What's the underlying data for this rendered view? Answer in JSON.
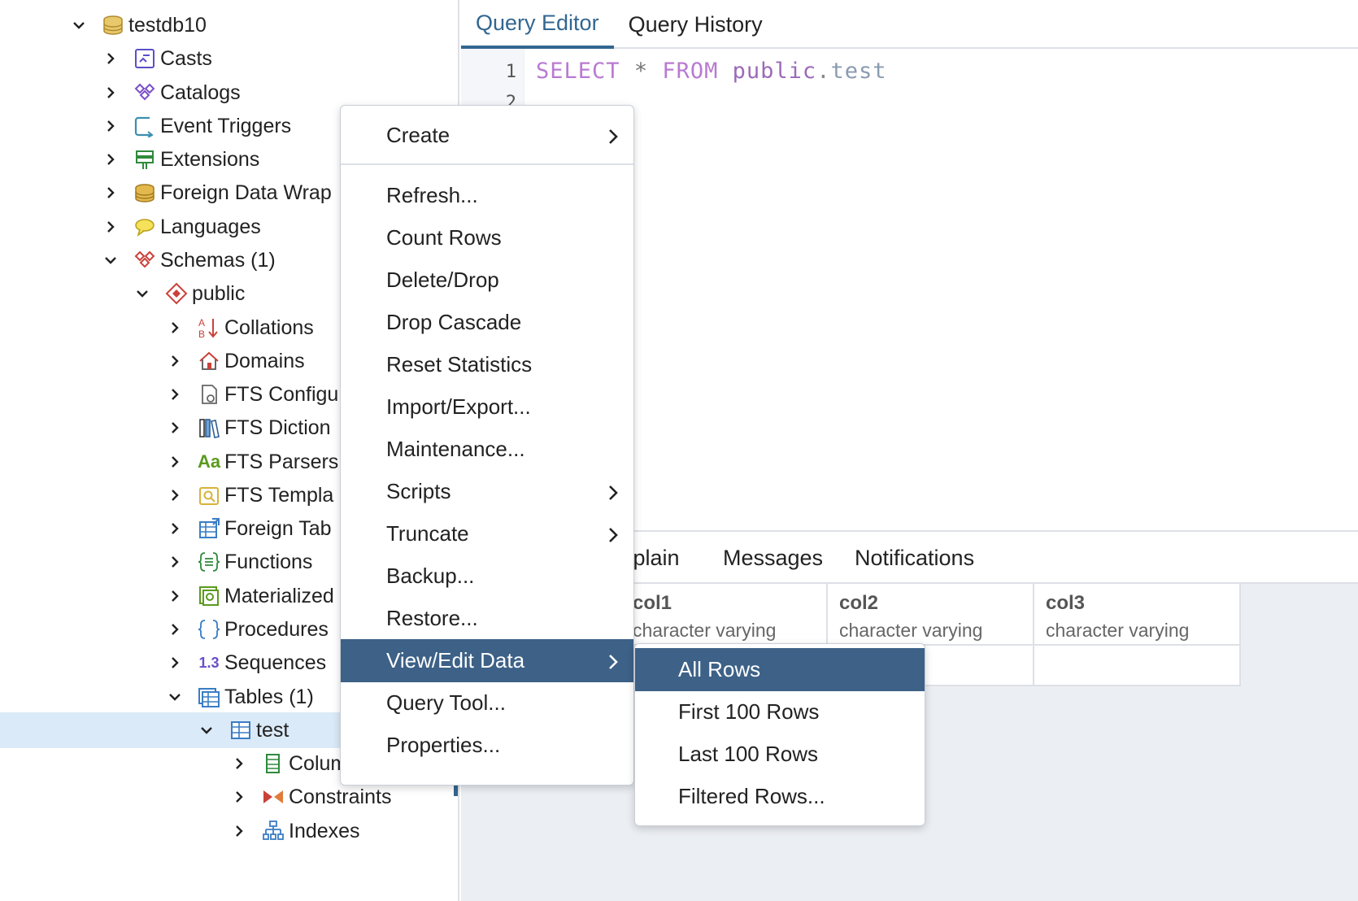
{
  "tree": {
    "items": [
      {
        "label": "testdb10",
        "icon": "database-icon"
      },
      {
        "label": "Casts",
        "icon": "casts-icon"
      },
      {
        "label": "Catalogs",
        "icon": "catalogs-icon"
      },
      {
        "label": "Event Triggers",
        "icon": "event-triggers-icon"
      },
      {
        "label": "Extensions",
        "icon": "extensions-icon"
      },
      {
        "label": "Foreign Data Wrap",
        "icon": "foreign-data-wrapper-icon"
      },
      {
        "label": "Languages",
        "icon": "languages-icon"
      },
      {
        "label": "Schemas (1)",
        "icon": "schemas-icon"
      },
      {
        "label": "public",
        "icon": "schema-icon"
      },
      {
        "label": "Collations",
        "icon": "collations-icon"
      },
      {
        "label": "Domains",
        "icon": "domains-icon"
      },
      {
        "label": "FTS Configu",
        "icon": "fts-config-icon"
      },
      {
        "label": "FTS Diction",
        "icon": "fts-dictionary-icon"
      },
      {
        "label": "FTS Parsers",
        "icon": "fts-parsers-icon",
        "glyph": "Aa"
      },
      {
        "label": "FTS Templa",
        "icon": "fts-templates-icon"
      },
      {
        "label": "Foreign Tab",
        "icon": "foreign-tables-icon"
      },
      {
        "label": "Functions",
        "icon": "functions-icon"
      },
      {
        "label": "Materialized",
        "icon": "materialized-views-icon"
      },
      {
        "label": "Procedures",
        "icon": "procedures-icon"
      },
      {
        "label": "Sequences",
        "icon": "sequences-icon",
        "glyph": "1.3"
      },
      {
        "label": "Tables (1)",
        "icon": "tables-icon"
      },
      {
        "label": "test",
        "icon": "table-icon"
      },
      {
        "label": "Columns",
        "icon": "columns-icon"
      },
      {
        "label": "Constraints",
        "icon": "constraints-icon"
      },
      {
        "label": "Indexes",
        "icon": "indexes-icon"
      }
    ],
    "selected": "test"
  },
  "editor": {
    "tabs": [
      "Query Editor",
      "Query History"
    ],
    "active_tab": "Query Editor",
    "line_numbers": [
      "1",
      "2"
    ],
    "code": {
      "kw1": "SELECT",
      "star": "*",
      "kw2": "FROM",
      "schema": "public",
      "dot": ".",
      "table": "test"
    }
  },
  "results": {
    "tabs": [
      "Explain",
      "Messages",
      "Notifications"
    ],
    "columns": [
      {
        "name": "col1",
        "type": "character varying"
      },
      {
        "name": "col2",
        "type": "character varying"
      },
      {
        "name": "col3",
        "type": "character varying"
      }
    ]
  },
  "context_menu": {
    "items": [
      {
        "label": "Create",
        "submenu": true
      },
      {
        "label": "Refresh..."
      },
      {
        "label": "Count Rows"
      },
      {
        "label": "Delete/Drop"
      },
      {
        "label": "Drop Cascade"
      },
      {
        "label": "Reset Statistics"
      },
      {
        "label": "Import/Export..."
      },
      {
        "label": "Maintenance..."
      },
      {
        "label": "Scripts",
        "submenu": true
      },
      {
        "label": "Truncate",
        "submenu": true
      },
      {
        "label": "Backup..."
      },
      {
        "label": "Restore..."
      },
      {
        "label": "View/Edit Data",
        "submenu": true,
        "active": true
      },
      {
        "label": "Query Tool..."
      },
      {
        "label": "Properties..."
      }
    ]
  },
  "sub_menu": {
    "items": [
      {
        "label": "All Rows",
        "active": true
      },
      {
        "label": "First 100 Rows"
      },
      {
        "label": "Last 100 Rows"
      },
      {
        "label": "Filtered Rows..."
      }
    ]
  },
  "colors": {
    "accent": "#326690",
    "menu_highlight": "#3d6187",
    "tree_selected": "#dbeaf8",
    "keyword": "#b97ad1"
  }
}
